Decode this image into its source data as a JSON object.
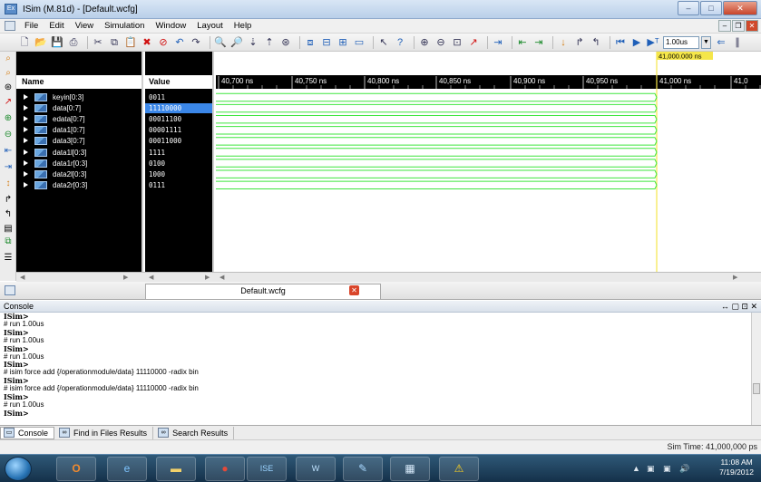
{
  "window": {
    "title": "ISim (M.81d) - [Default.wcfg]",
    "minimize": "–",
    "maximize": "□",
    "close": "✕"
  },
  "menu": [
    "File",
    "Edit",
    "View",
    "Simulation",
    "Window",
    "Layout",
    "Help"
  ],
  "toolbar": {
    "run_time": "1.00us"
  },
  "columns": {
    "name": "Name",
    "value": "Value"
  },
  "signals": [
    {
      "name": "keyin[0:3]",
      "value": "0011"
    },
    {
      "name": "data[0:7]",
      "value": "11110000"
    },
    {
      "name": "edata[0:7]",
      "value": "00011100"
    },
    {
      "name": "data1[0:7]",
      "value": "00001111"
    },
    {
      "name": "data3[0:7]",
      "value": "00011000"
    },
    {
      "name": "data1l[0:3]",
      "value": "1111"
    },
    {
      "name": "data1r[0:3]",
      "value": "0100"
    },
    {
      "name": "data2l[0:3]",
      "value": "1000"
    },
    {
      "name": "data2r[0:3]",
      "value": "0111"
    }
  ],
  "selected_signal_index": 1,
  "timeline": {
    "ticks": [
      "40,700 ns",
      "40,750 ns",
      "40,800 ns",
      "40,850 ns",
      "40,900 ns",
      "40,950 ns",
      "41,000 ns",
      "41,0"
    ],
    "cursor_label": "41,000.000 ns",
    "x1_label": "X1: 41,000.000 ns"
  },
  "doc_tab": {
    "label": "Default.wcfg",
    "close": "✕"
  },
  "console": {
    "title": "Console",
    "controls": "↔ ▢ ⊡ ✕",
    "lines": [
      {
        "text": "ISim>",
        "bold": true
      },
      {
        "text": "# run 1.00us",
        "bold": false
      },
      {
        "text": "ISim>",
        "bold": true
      },
      {
        "text": "# run 1.00us",
        "bold": false
      },
      {
        "text": "ISim>",
        "bold": true
      },
      {
        "text": "# run 1.00us",
        "bold": false
      },
      {
        "text": "ISim>",
        "bold": true
      },
      {
        "text": "# isim force add {/operationmodule/data} 11110000 -radix bin",
        "bold": false
      },
      {
        "text": "ISim>",
        "bold": true
      },
      {
        "text": "# isim force add {/operationmodule/data} 11110000 -radix bin",
        "bold": false
      },
      {
        "text": "ISim>",
        "bold": true
      },
      {
        "text": "# run 1.00us",
        "bold": false
      },
      {
        "text": "ISim>",
        "bold": true
      }
    ]
  },
  "bottom_tabs": [
    "Console",
    "Find in Files Results",
    "Search Results"
  ],
  "status": {
    "sim_time": "Sim Time: 41,000,000 ps"
  },
  "taskbar": {
    "time": "11:08 AM",
    "date": "7/19/2012"
  },
  "colors": {
    "wave": "#3ee63e",
    "cursor": "#f5e64a",
    "selected_row": "#3b87e8"
  }
}
